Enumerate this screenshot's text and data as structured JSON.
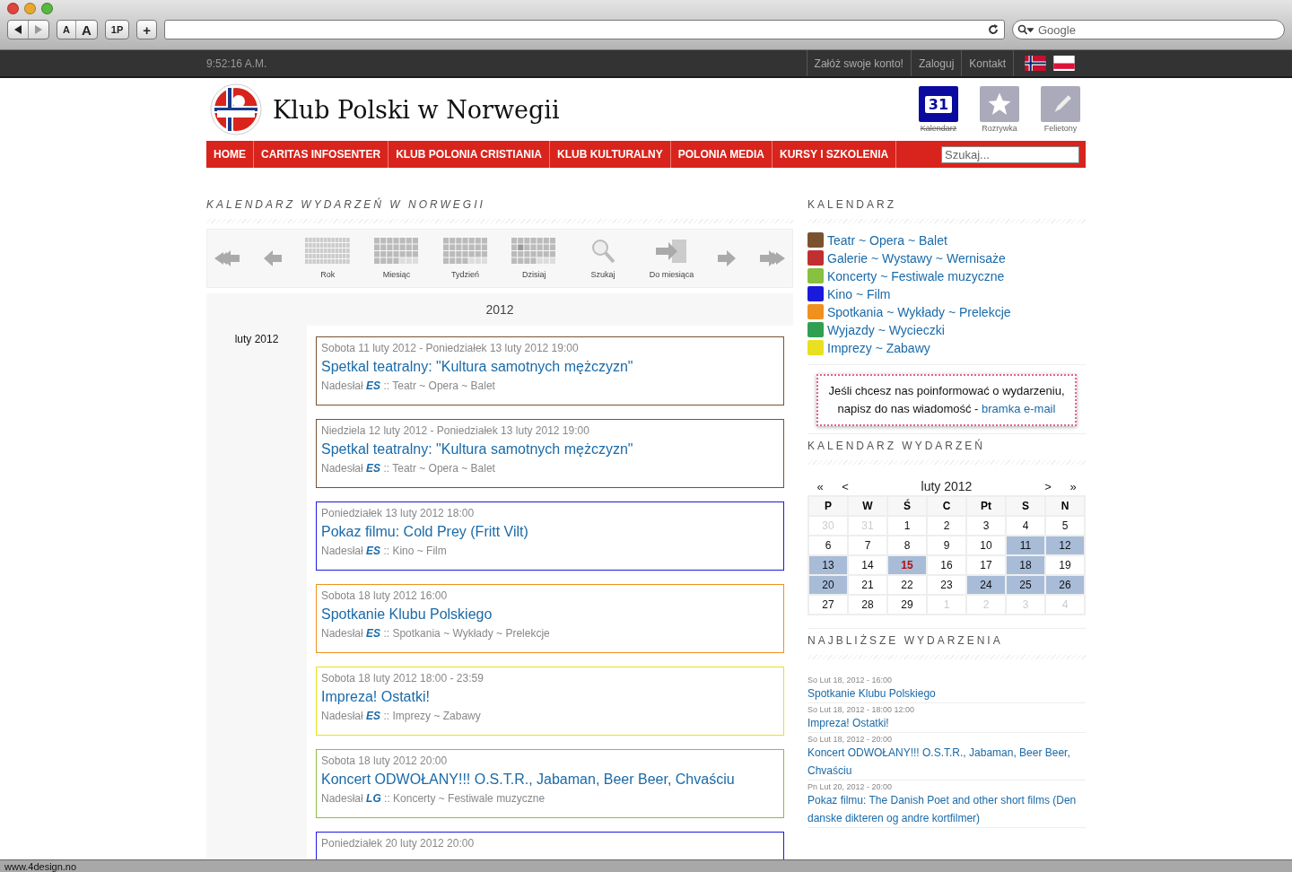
{
  "browser": {
    "font_buttons": [
      "A",
      "A"
    ],
    "bookmark_button": "1P",
    "add_button": "+",
    "search": {
      "placeholder": "Google"
    },
    "status": "www.4design.no"
  },
  "topbar": {
    "clock": "9:52:16 A.M.",
    "links": [
      "Załóż swoje konto!",
      "Zaloguj",
      "Kontakt"
    ],
    "flags": [
      {
        "kind": "norway"
      },
      {
        "kind": "poland"
      }
    ]
  },
  "header": {
    "title": "Klub Polski w Norwegii",
    "shortcuts": [
      {
        "kind": "calendar",
        "icon_text": "31",
        "label": "Kalendarz",
        "selected": true
      },
      {
        "kind": "star",
        "label": "Rozrywka",
        "selected": false
      },
      {
        "kind": "pen",
        "label": "Felietony",
        "selected": false
      }
    ]
  },
  "nav": {
    "items": [
      "HOME",
      "CARITAS INFOSENTER",
      "KLUB POLONIA CRISTIANIA",
      "KLUB KULTURALNY",
      "POLONIA MEDIA",
      "KURSY I SZKOLENIA"
    ],
    "search": {
      "placeholder": "Szukaj..."
    }
  },
  "main": {
    "heading": "KALENDARZ WYDARZEŃ W NORWEGII",
    "toolbar": [
      {
        "kind": "first"
      },
      {
        "kind": "prev"
      },
      {
        "kind": "year",
        "label": "Rok"
      },
      {
        "kind": "month",
        "label": "Miesiąc"
      },
      {
        "kind": "week",
        "label": "Tydzień"
      },
      {
        "kind": "today",
        "label": "Dzisiaj"
      },
      {
        "kind": "search",
        "label": "Szukaj"
      },
      {
        "kind": "tomonth",
        "label": "Do miesiąca"
      },
      {
        "kind": "next"
      },
      {
        "kind": "last"
      }
    ],
    "year": "2012",
    "month": "luty 2012",
    "events": [
      {
        "date": "Sobota 11 luty 2012 - Poniedziałek 13 luty 2012 19:00",
        "title": "Spetkal teatralny: \"Kultura samotnych mężczyzn\"",
        "by_label": "Nadesłał",
        "author": "ES",
        "sep": "::",
        "category": "Teatr ~ Opera ~ Balet",
        "color": "#7a5230"
      },
      {
        "date": "Niedziela 12 luty 2012 - Poniedziałek 13 luty 2012 19:00",
        "title": "Spetkal teatralny: \"Kultura samotnych mężczyzn\"",
        "by_label": "Nadesłał",
        "author": "ES",
        "sep": "::",
        "category": "Teatr ~ Opera ~ Balet",
        "color": "#7a5230"
      },
      {
        "date": "Poniedziałek 13 luty 2012 18:00",
        "title": "Pokaz filmu: Cold Prey (Fritt Vilt)",
        "by_label": "Nadesłał",
        "author": "ES",
        "sep": "::",
        "category": "Kino ~ Film",
        "color": "#1a1adc"
      },
      {
        "date": "Sobota 18 luty 2012 16:00",
        "title": "Spotkanie Klubu Polskiego",
        "by_label": "Nadesłał",
        "author": "ES",
        "sep": "::",
        "category": "Spotkania ~ Wykłady ~ Prelekcje",
        "color": "#f0901e"
      },
      {
        "date": "Sobota 18 luty 2012 18:00 - 23:59",
        "title": "Impreza! Ostatki!",
        "by_label": "Nadesłał",
        "author": "ES",
        "sep": "::",
        "category": "Imprezy ~ Zabawy",
        "color": "#e8e020"
      },
      {
        "date": "Sobota 18 luty 2012 20:00",
        "title": "Koncert ODWOŁANY!!! O.S.T.R., Jabaman, Beer Beer, Chvaściu",
        "by_label": "Nadesłał",
        "author": "LG",
        "sep": "::",
        "category": "Koncerty ~ Festiwale muzyczne",
        "color": "#88c040"
      },
      {
        "date": "Poniedziałek 20 luty 2012 20:00",
        "color": "#1a1adc"
      }
    ]
  },
  "sidebar": {
    "categories_heading": "KALENDARZ",
    "categories": [
      {
        "label": "Teatr ~ Opera ~ Balet",
        "color": "#7a5230"
      },
      {
        "label": "Galerie ~ Wystawy ~ Wernisaże",
        "color": "#c03030"
      },
      {
        "label": "Koncerty ~ Festiwale muzyczne",
        "color": "#88c040"
      },
      {
        "label": "Kino ~ Film",
        "color": "#1a1adc"
      },
      {
        "label": "Spotkania ~ Wykłady ~ Prelekcje",
        "color": "#f0901e"
      },
      {
        "label": "Wyjazdy ~ Wycieczki",
        "color": "#30a050"
      },
      {
        "label": "Imprezy ~ Zabawy",
        "color": "#e8e020"
      }
    ],
    "notice": {
      "text": "Jeśli chcesz nas poinformować o wydarzeniu, napisz do nas wiadomość -",
      "link": "bramka e-mail"
    },
    "calendar_heading": "KALENDARZ WYDARZEŃ",
    "calendar": {
      "nav": [
        "«",
        "<"
      ],
      "nav_right": [
        ">",
        "»"
      ],
      "month": "luty 2012",
      "weekdays": [
        "P",
        "W",
        "Ś",
        "C",
        "Pt",
        "S",
        "N"
      ],
      "days": [
        {
          "day": "30",
          "kind": "outside"
        },
        {
          "day": "31",
          "kind": "outside"
        },
        {
          "day": "1",
          "kind": "plain"
        },
        {
          "day": "2",
          "kind": "plain"
        },
        {
          "day": "3",
          "kind": "plain"
        },
        {
          "day": "4",
          "kind": "plain"
        },
        {
          "day": "5",
          "kind": "plain"
        },
        {
          "day": "6",
          "kind": "plain"
        },
        {
          "day": "7",
          "kind": "plain"
        },
        {
          "day": "8",
          "kind": "plain"
        },
        {
          "day": "9",
          "kind": "plain"
        },
        {
          "day": "10",
          "kind": "plain"
        },
        {
          "day": "11",
          "kind": "event"
        },
        {
          "day": "12",
          "kind": "event"
        },
        {
          "day": "13",
          "kind": "event"
        },
        {
          "day": "14",
          "kind": "plain"
        },
        {
          "day": "15",
          "kind": "today"
        },
        {
          "day": "16",
          "kind": "plain"
        },
        {
          "day": "17",
          "kind": "plain"
        },
        {
          "day": "18",
          "kind": "event"
        },
        {
          "day": "19",
          "kind": "plain"
        },
        {
          "day": "20",
          "kind": "event"
        },
        {
          "day": "21",
          "kind": "plain"
        },
        {
          "day": "22",
          "kind": "plain"
        },
        {
          "day": "23",
          "kind": "plain"
        },
        {
          "day": "24",
          "kind": "event"
        },
        {
          "day": "25",
          "kind": "event"
        },
        {
          "day": "26",
          "kind": "event"
        },
        {
          "day": "27",
          "kind": "plain"
        },
        {
          "day": "28",
          "kind": "plain"
        },
        {
          "day": "29",
          "kind": "plain"
        },
        {
          "day": "1",
          "kind": "outside"
        },
        {
          "day": "2",
          "kind": "outside"
        },
        {
          "day": "3",
          "kind": "outside"
        },
        {
          "day": "4",
          "kind": "outside"
        }
      ]
    },
    "upcoming_heading": "NAJBLIŻSZE WYDARZENIA",
    "upcoming": [
      {
        "date": "So Lut 18, 2012 - 16:00",
        "title": "Spotkanie Klubu Polskiego"
      },
      {
        "date": "So Lut 18, 2012 - 18:00 12:00",
        "title": "Impreza! Ostatki!"
      },
      {
        "date": "So Lut 18, 2012 - 20:00",
        "title": "Koncert ODWOŁANY!!! O.S.T.R., Jabaman, Beer Beer, Chvaściu"
      },
      {
        "date": "Pn Lut 20, 2012 - 20:00",
        "title": "Pokaz filmu: The Danish Poet and other short films (Den danske dikteren og andre kortfilmer)"
      }
    ]
  }
}
